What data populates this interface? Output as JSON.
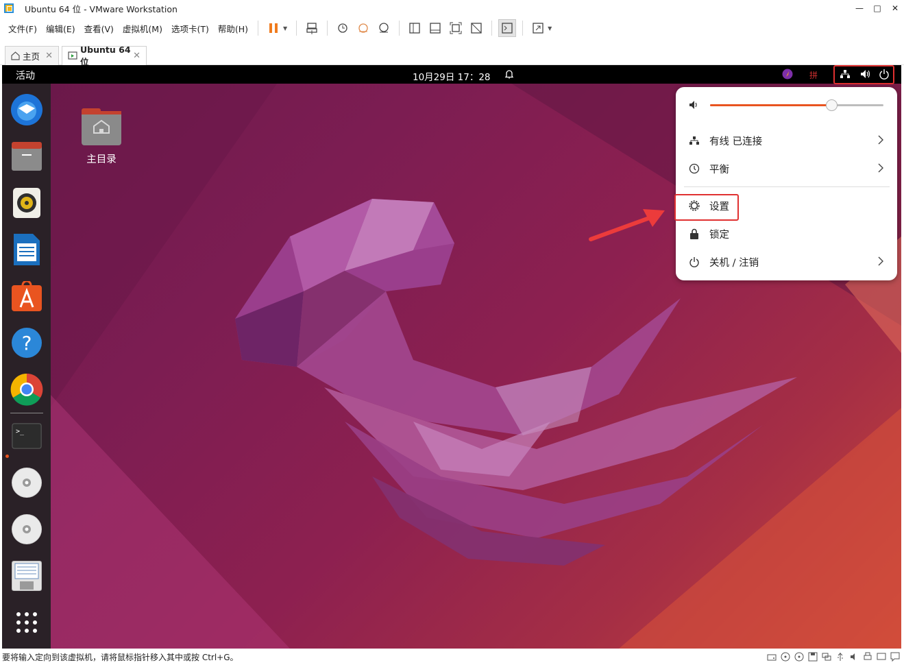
{
  "window": {
    "title": "Ubuntu 64 位 - VMware Workstation",
    "controls": {
      "minimize": "—",
      "maximize": "□",
      "close": "✕"
    }
  },
  "menubar": {
    "items": [
      "文件(F)",
      "编辑(E)",
      "查看(V)",
      "虚拟机(M)",
      "选项卡(T)",
      "帮助(H)"
    ]
  },
  "tabs": [
    {
      "label": "主页",
      "close": "✕"
    },
    {
      "label": "Ubuntu 64 位",
      "close": "✕"
    }
  ],
  "ubuntu": {
    "activities": "活动",
    "clock": "10月29日  17：28",
    "tray_ime": "拼",
    "desktop_icon_label": "主目录",
    "quick_settings": {
      "volume_level": 0.7,
      "rows": [
        {
          "label": "有线 已连接",
          "icon": "network-wired-icon",
          "chevron": true
        },
        {
          "label": "平衡",
          "icon": "power-profile-icon",
          "chevron": true
        },
        {
          "label": "设置",
          "icon": "gear-icon",
          "chevron": false
        },
        {
          "label": "锁定",
          "icon": "lock-icon",
          "chevron": false
        },
        {
          "label": "关机 / 注销",
          "icon": "power-icon",
          "chevron": true
        }
      ]
    }
  },
  "statusbar": {
    "text": "要将输入定向到该虚拟机，请将鼠标指针移入其中或按 Ctrl+G。"
  },
  "colors": {
    "ubuntu_orange": "#e95420",
    "highlight_red": "#e03030",
    "dock_bg": "#2a2127"
  }
}
